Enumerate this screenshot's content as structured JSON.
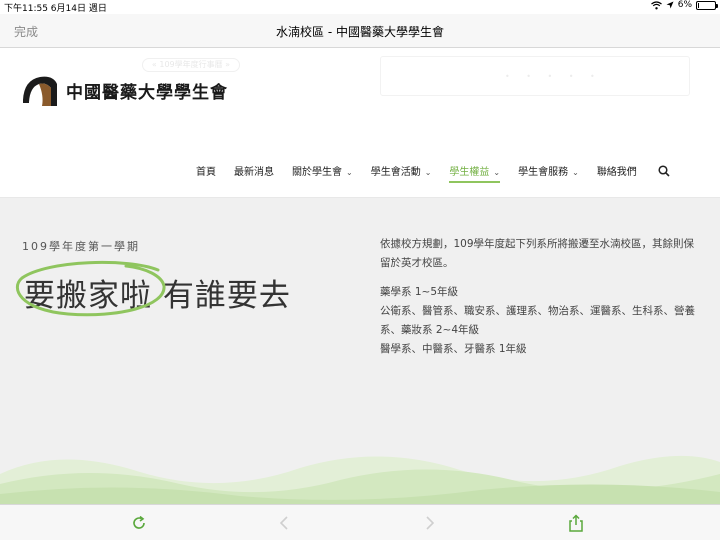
{
  "status_bar": {
    "time_date": "下午11:55   6月14日 週日",
    "battery_percent": "6%",
    "battery_level": 0.06
  },
  "nav_bar": {
    "done_label": "完成",
    "page_title": "水湳校區 - 中國醫藥大學學生會"
  },
  "site": {
    "logo_text": "中國醫藥大學學生會",
    "faded_banner": "« 109學年度行事曆 »",
    "faded_dots": "• • • • •",
    "menu": [
      {
        "label": "首頁",
        "has_dropdown": false,
        "active": false
      },
      {
        "label": "最新消息",
        "has_dropdown": false,
        "active": false
      },
      {
        "label": "關於學生會",
        "has_dropdown": true,
        "active": false
      },
      {
        "label": "學生會活動",
        "has_dropdown": true,
        "active": false
      },
      {
        "label": "學生權益",
        "has_dropdown": true,
        "active": true
      },
      {
        "label": "學生會服務",
        "has_dropdown": true,
        "active": false
      },
      {
        "label": "聯絡我們",
        "has_dropdown": false,
        "active": false
      }
    ]
  },
  "content": {
    "semester": "109學年度第一學期",
    "headline": "要搬家啦 有誰要去",
    "intro": "依據校方規劃，109學年度起下列系所將搬遷至水湳校區，其餘則保留於英才校區。",
    "line1": "藥學系 1~5年級",
    "line2": "公衛系、醫管系、職安系、護理系、物治系、運醫系、生科系、營養系、藥妝系 2~4年級",
    "line3": "醫學系、中醫系、牙醫系 1年級"
  },
  "colors": {
    "accent_green": "#8fc55e",
    "active_menu_text": "#73b043",
    "ios_green": "#5aa83c"
  }
}
